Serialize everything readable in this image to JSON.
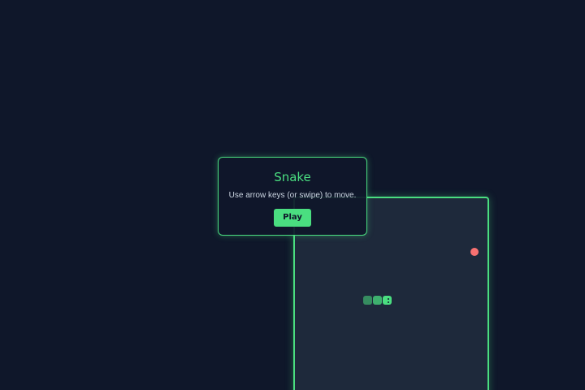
{
  "game": {
    "title": "Snake",
    "instructions": "Use arrow keys (or swipe) to move.",
    "play_label": "Play"
  },
  "colors": {
    "background": "#0f172a",
    "board": "#1e293b",
    "accent": "#4ade80",
    "food": "#f87171",
    "text": "#cbd5e1"
  },
  "snake": {
    "length": 3,
    "direction": "right"
  }
}
